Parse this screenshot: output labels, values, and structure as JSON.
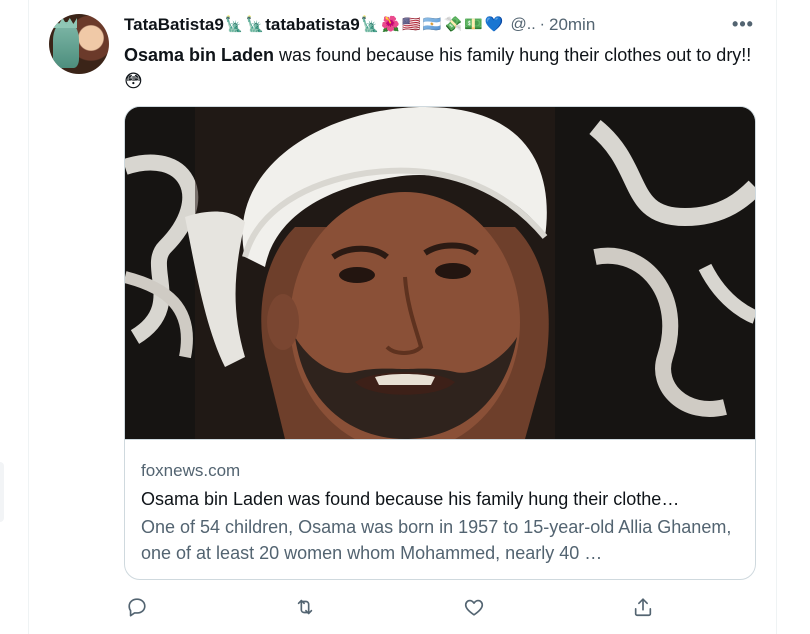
{
  "tweet": {
    "display_name": "TataBatista9",
    "name_emoji_1": "🗽",
    "name_emoji_2": "🗽",
    "display_name_2": "tatabatista9",
    "name_emojis_tail": [
      "🗽",
      "🌺",
      "🇺🇸",
      "🇦🇷",
      "💸",
      "💵",
      "💙"
    ],
    "handle": "@..",
    "separator": "·",
    "time": "20min",
    "more_label": "•••",
    "text_bold": "Osama bin Laden",
    "text_rest": " was found because his family hung their clothes out to dry!! ",
    "text_emoji": "😳"
  },
  "card": {
    "domain": "foxnews.com",
    "title": "Osama bin Laden was found because his family hung their clothe…",
    "description": "One of 54 children, Osama was born in 1957 to 15-year-old Allia Ghanem, one of at least 20 women whom Mohammed, nearly 40 …"
  },
  "actions": {
    "icons": [
      "reply-icon",
      "retweet-icon",
      "like-icon",
      "share-icon"
    ]
  },
  "colors": {
    "text_primary": "#0f1419",
    "text_secondary": "#536471",
    "border": "#cfd9de"
  }
}
